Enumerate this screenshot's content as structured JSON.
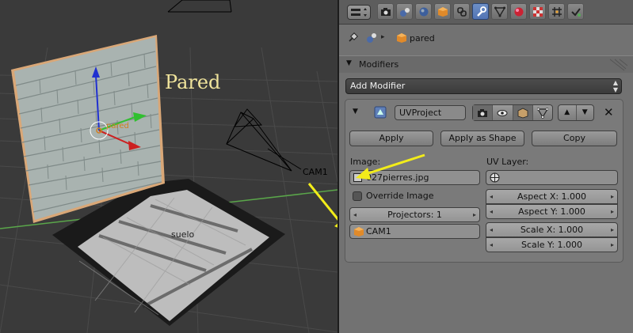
{
  "viewport": {
    "wall_label": "Pared",
    "floor_label": "suelo",
    "camera_label": "CAM1",
    "object_origin_label": "pared"
  },
  "header": {
    "tabs": [
      "render",
      "scene",
      "world",
      "object",
      "constraints",
      "modifiers",
      "data",
      "material",
      "texture",
      "particles",
      "physics"
    ],
    "active_tab": "modifiers"
  },
  "breadcrumb": {
    "object_name": "pared"
  },
  "modifiers_panel": {
    "title": "Modifiers",
    "add_modifier_label": "Add Modifier"
  },
  "modifier": {
    "name": "UVProject",
    "apply_label": "Apply",
    "apply_shape_label": "Apply as Shape",
    "copy_label": "Copy",
    "image_label": "Image:",
    "image_value": "027pierres.jpg",
    "uv_layer_label": "UV Layer:",
    "uv_layer_value": "",
    "override_image_label": "Override Image",
    "override_image_checked": false,
    "projectors_label": "Projectors: 1",
    "projector_value": "CAM1",
    "aspect_x": "Aspect X: 1.000",
    "aspect_y": "Aspect Y: 1.000",
    "scale_x": "Scale X: 1.000",
    "scale_y": "Scale Y: 1.000"
  },
  "colors": {
    "panel_bg": "#727272",
    "active_tab": "#5a7dbe",
    "annotation_arrow": "#f2ec1a",
    "wall_label": "#f0e49c",
    "x_axis": "#cc2020",
    "y_axis": "#30c030",
    "z_axis": "#2030d0"
  }
}
